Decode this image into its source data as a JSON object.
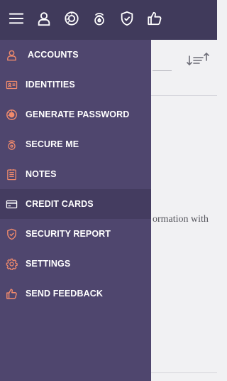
{
  "topbar": {
    "icons": [
      "menu-icon",
      "user-icon",
      "password-dial-icon",
      "secure-me-icon",
      "shield-check-icon",
      "thumbs-up-icon"
    ]
  },
  "menu": {
    "items": [
      {
        "label": "ACCOUNTS",
        "icon": "user-icon"
      },
      {
        "label": "IDENTITIES",
        "icon": "id-card-icon"
      },
      {
        "label": "GENERATE PASSWORD",
        "icon": "password-dial-icon"
      },
      {
        "label": "SECURE ME",
        "icon": "secure-me-icon"
      },
      {
        "label": "NOTES",
        "icon": "notes-icon"
      },
      {
        "label": "CREDIT CARDS",
        "icon": "credit-card-icon"
      },
      {
        "label": "SECURITY REPORT",
        "icon": "shield-check-icon"
      },
      {
        "label": "SETTINGS",
        "icon": "gear-icon"
      },
      {
        "label": "SEND FEEDBACK",
        "icon": "thumbs-up-icon"
      }
    ],
    "active_index": 5
  },
  "content": {
    "body_text": "ormation with"
  },
  "colors": {
    "topbar": "#403a5b",
    "drawer": "#4f466e",
    "drawer_active": "#443c60",
    "accent_icon": "#f08a6c"
  }
}
